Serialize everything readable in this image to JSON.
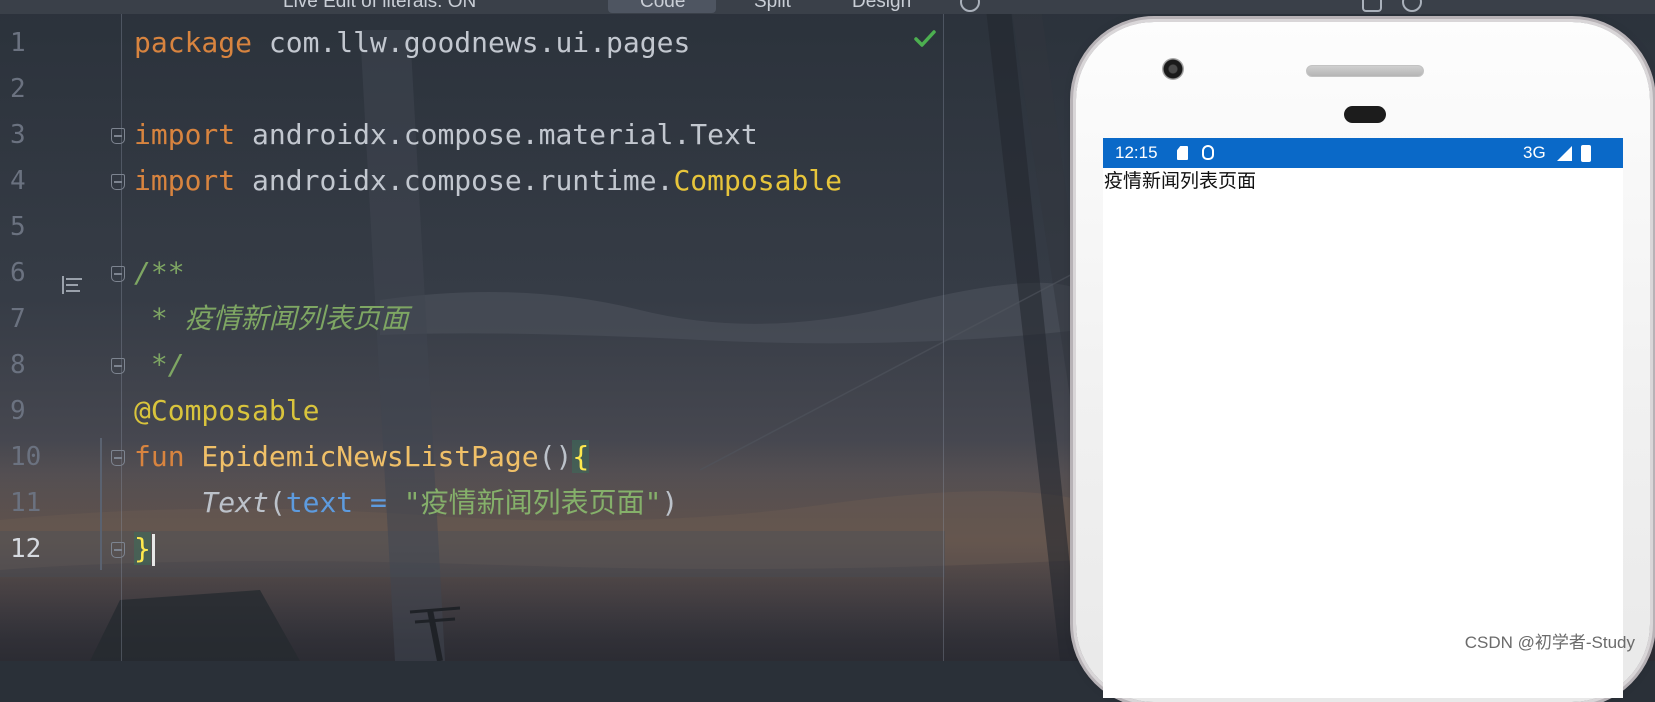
{
  "toolbar": {
    "live_edit_label": "Live Edit of literals: ON",
    "code_label": "Code",
    "split_label": "Split",
    "design_label": "Design"
  },
  "editor": {
    "line_numbers": [
      "1",
      "2",
      "3",
      "4",
      "5",
      "6",
      "7",
      "8",
      "9",
      "10",
      "11",
      "12"
    ],
    "current_line": "12",
    "lines": {
      "l1": {
        "kw": "package",
        "rest": " com.llw.goodnews.ui.pages"
      },
      "l3": {
        "kw": "import",
        "rest": " androidx.compose.material.Text"
      },
      "l4": {
        "kw": "import",
        "rest": " androidx.compose.runtime.",
        "cls": "Composable"
      },
      "l6": {
        "comment": "/**"
      },
      "l7": {
        "comment": " * 疫情新闻列表页面"
      },
      "l8": {
        "comment": " */"
      },
      "l9": {
        "annotation": "@Composable"
      },
      "l10": {
        "kw": "fun",
        "fn": " EpidemicNewsListPage",
        "parens": "()",
        "brace": "{"
      },
      "l11": {
        "indent": "    ",
        "call": "Text",
        "open": "(",
        "param": "text",
        "eq": " = ",
        "str": "\"疫情新闻列表页面\"",
        "close": ")"
      },
      "l12": {
        "brace": "}"
      }
    },
    "status_icon": "check-icon"
  },
  "preview": {
    "status_bar": {
      "time": "12:15",
      "network": "3G",
      "icons": [
        "sd-card-icon",
        "debug-icon",
        "signal-icon",
        "battery-icon"
      ]
    },
    "screen_text": "疫情新闻列表页面"
  },
  "watermark": "CSDN @初学者-Study",
  "colors": {
    "keyword": "#d8843f",
    "annotation": "#d9c43c",
    "comment": "#7ea663",
    "string": "#85b06a",
    "param": "#5d9bdf",
    "status_bar": "#0a69c8"
  }
}
